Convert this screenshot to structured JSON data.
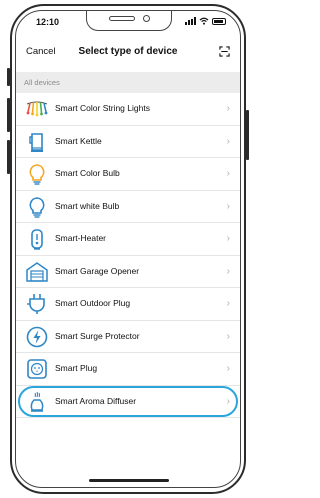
{
  "status": {
    "time": "12:10"
  },
  "navbar": {
    "cancel_label": "Cancel",
    "title": "Select type of device",
    "scan_icon": "scan-icon"
  },
  "section": {
    "label": "All devices"
  },
  "devices": [
    {
      "label": "Smart Color String Lights",
      "icon": "string-lights-icon"
    },
    {
      "label": "Smart Kettle",
      "icon": "kettle-icon"
    },
    {
      "label": "Smart Color Bulb",
      "icon": "color-bulb-icon"
    },
    {
      "label": "Smart white Bulb",
      "icon": "white-bulb-icon"
    },
    {
      "label": "Smart-Heater",
      "icon": "heater-icon"
    },
    {
      "label": "Smart Garage Opener",
      "icon": "garage-icon"
    },
    {
      "label": "Smart Outdoor Plug",
      "icon": "outdoor-plug-icon"
    },
    {
      "label": "Smart Surge Protector",
      "icon": "surge-protector-icon"
    },
    {
      "label": "Smart Plug",
      "icon": "plug-icon"
    },
    {
      "label": "Smart Aroma Diffuser",
      "icon": "aroma-diffuser-icon",
      "highlighted": true
    }
  ],
  "colors": {
    "accent": "#2aa6dc",
    "icon_blue": "#2f86c6",
    "section_bg": "#ececec"
  }
}
